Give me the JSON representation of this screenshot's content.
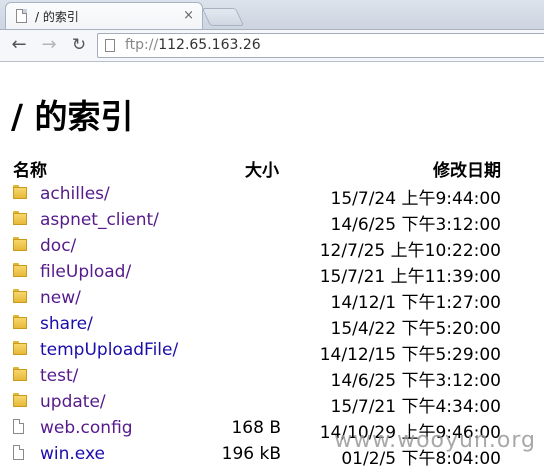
{
  "tab": {
    "title": "/ 的索引",
    "close": "×"
  },
  "toolbar": {
    "back": "←",
    "forward": "→",
    "reload": "↻",
    "url_scheme": "ftp://",
    "url_host": "112.65.163.26"
  },
  "page": {
    "heading": "/ 的索引",
    "columns": {
      "name": "名称",
      "size": "大小",
      "date": "修改日期"
    },
    "rows": [
      {
        "name": "achilles/",
        "size": "",
        "date": "15/7/24 上午9:44:00",
        "type": "folder",
        "visited": true
      },
      {
        "name": "aspnet_client/",
        "size": "",
        "date": "14/6/25 下午3:12:00",
        "type": "folder",
        "visited": true
      },
      {
        "name": "doc/",
        "size": "",
        "date": "12/7/25 上午10:22:00",
        "type": "folder",
        "visited": true
      },
      {
        "name": "fileUpload/",
        "size": "",
        "date": "15/7/21 上午11:39:00",
        "type": "folder",
        "visited": true
      },
      {
        "name": "new/",
        "size": "",
        "date": "14/12/1 下午1:27:00",
        "type": "folder",
        "visited": true
      },
      {
        "name": "share/",
        "size": "",
        "date": "15/4/22 下午5:20:00",
        "type": "folder",
        "visited": false
      },
      {
        "name": "tempUploadFile/",
        "size": "",
        "date": "14/12/15 下午5:29:00",
        "type": "folder",
        "visited": false
      },
      {
        "name": "test/",
        "size": "",
        "date": "14/6/25 下午3:12:00",
        "type": "folder",
        "visited": true
      },
      {
        "name": "update/",
        "size": "",
        "date": "15/7/21 下午4:34:00",
        "type": "folder",
        "visited": true
      },
      {
        "name": "web.config",
        "size": "168 B",
        "date": "14/10/29 上午9:46:00",
        "type": "file",
        "visited": true
      },
      {
        "name": "win.exe",
        "size": "196 kB",
        "date": "01/2/5 下午8:04:00",
        "type": "file",
        "visited": false
      }
    ]
  },
  "watermark": "www.wooyun.org",
  "colors": {
    "link_visited": "#551a8b",
    "link": "#1a0dab",
    "folder": "#f7d66b"
  }
}
